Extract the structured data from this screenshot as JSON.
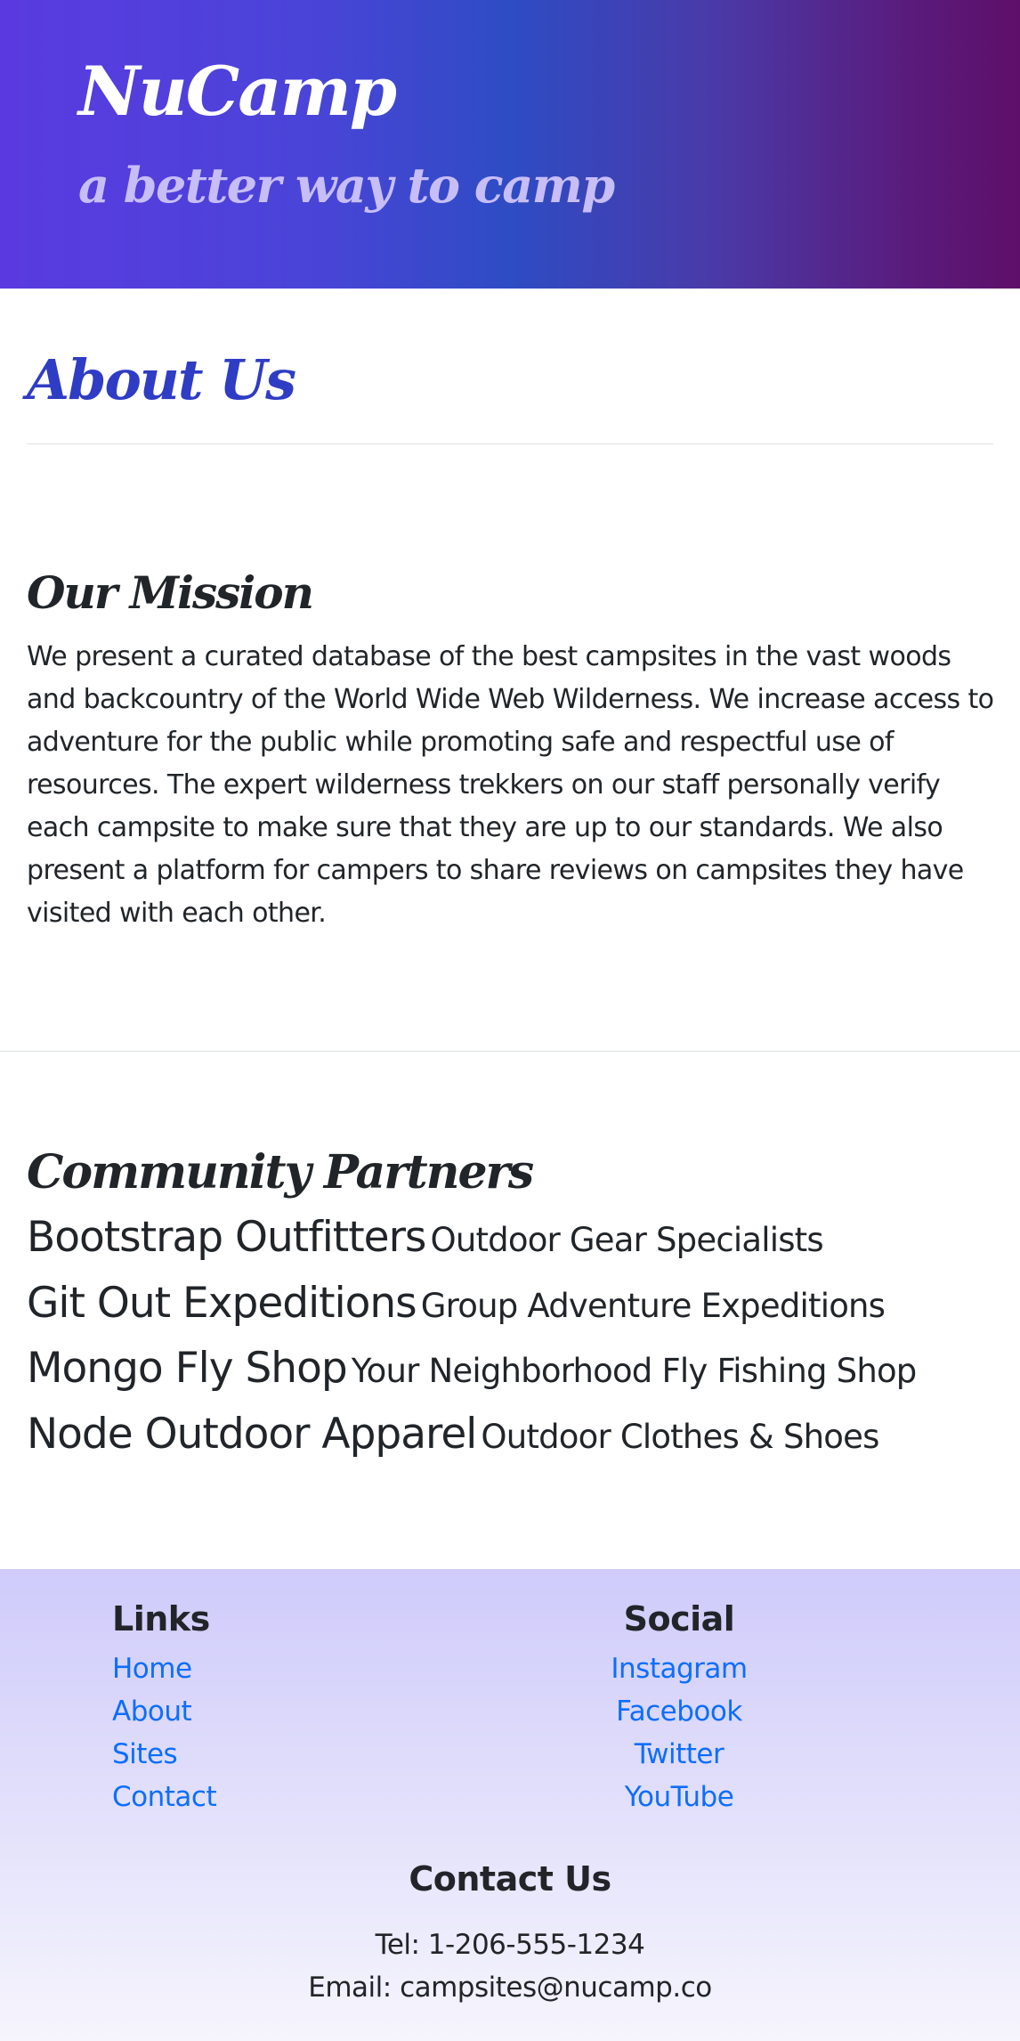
{
  "header": {
    "brand": "NuCamp",
    "tagline": "a better way to camp",
    "background_colors": [
      "#5a3ae0",
      "#2e4cc4",
      "#5e0f6a"
    ]
  },
  "page": {
    "title": "About Us",
    "title_color": "#2f3cc4"
  },
  "mission": {
    "heading": "Our Mission",
    "text": "We present a curated database of the best campsites in the vast woods and backcountry of the World Wide Web Wilderness. We increase access to adventure for the public while promoting safe and respectful use of resources. The expert wilderness trekkers on our staff personally verify each campsite to make sure that they are up to our standards. We also present a platform for campers to share reviews on campsites they have visited with each other."
  },
  "partners": {
    "heading": "Community Partners",
    "items": [
      {
        "name": "Bootstrap Outfitters",
        "description": "Outdoor Gear Specialists"
      },
      {
        "name": "Git Out Expeditions",
        "description": "Group Adventure Expeditions"
      },
      {
        "name": "Mongo Fly Shop",
        "description": "Your Neighborhood Fly Fishing Shop"
      },
      {
        "name": "Node Outdoor Apparel",
        "description": "Outdoor Clothes & Shoes"
      }
    ]
  },
  "footer": {
    "links": {
      "heading": "Links",
      "items": [
        "Home",
        "About",
        "Sites",
        "Contact"
      ]
    },
    "social": {
      "heading": "Social",
      "items": [
        "Instagram",
        "Facebook",
        "Twitter",
        "YouTube"
      ]
    },
    "contact": {
      "heading": "Contact Us",
      "tel": "Tel: 1-206-555-1234",
      "email": "Email: campsites@nucamp.co"
    },
    "link_color": "#0d6efd"
  }
}
